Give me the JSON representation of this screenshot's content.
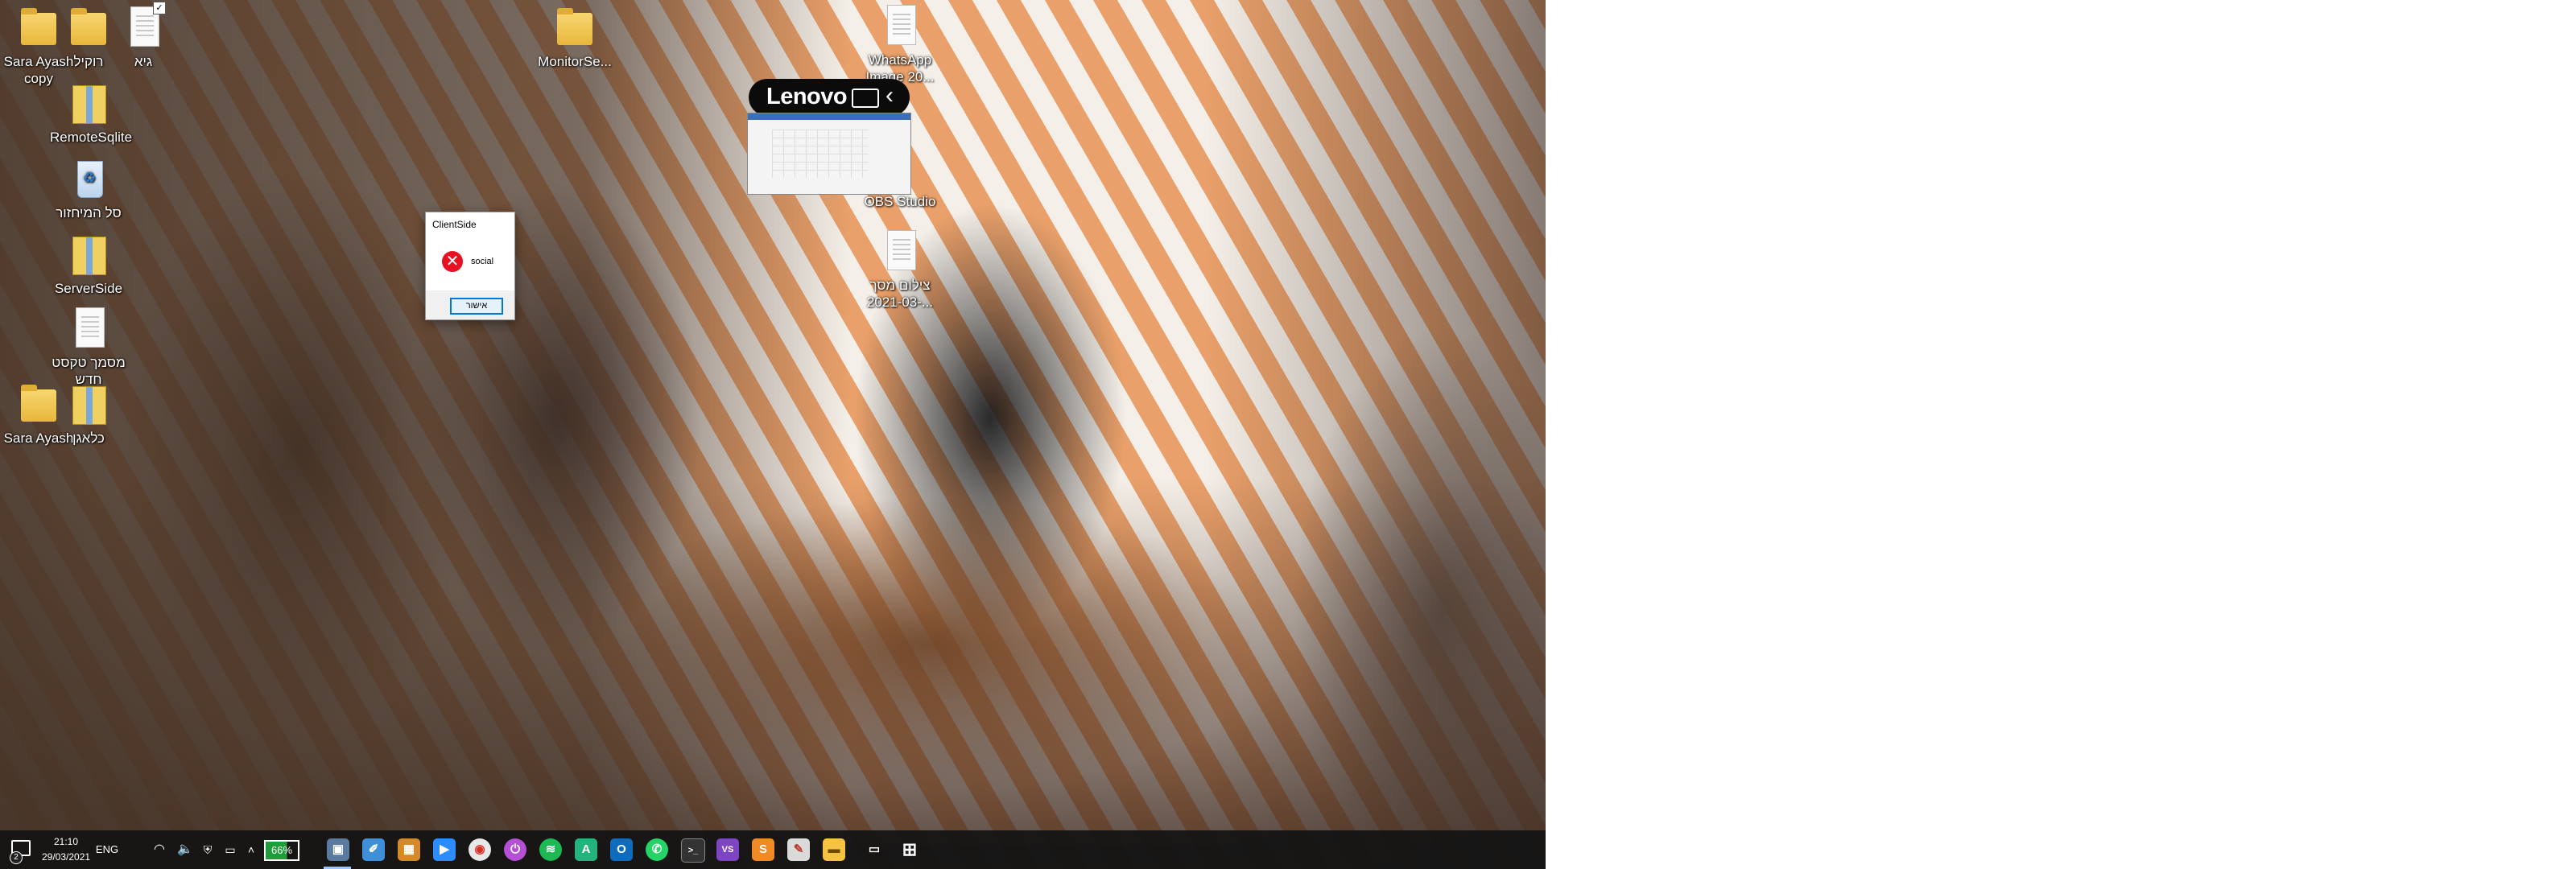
{
  "desktop": {
    "icons": [
      {
        "label": "Sara Ayash copy",
        "icon": "folder-icon"
      },
      {
        "label": "רוקיל",
        "icon": "folder-icon"
      },
      {
        "label": "גיא",
        "icon": "document-icon"
      },
      {
        "label": "MonitorSe...",
        "icon": "folder-icon"
      },
      {
        "label": "WhatsApp Image 20...",
        "icon": "image-file-icon"
      },
      {
        "label": "RemoteSqlite",
        "icon": "archive-icon"
      },
      {
        "label": "סל המיחזור",
        "icon": "recycle-bin-icon"
      },
      {
        "label": "OBS Studio",
        "icon": "obs-icon"
      },
      {
        "label": "ServerSide",
        "icon": "archive-icon"
      },
      {
        "label": "צילום מסך 2021-03-...",
        "icon": "image-file-icon"
      },
      {
        "label": "מסמך טקסט חדש",
        "icon": "text-file-icon"
      },
      {
        "label": "Sara Ayash",
        "icon": "folder-icon"
      },
      {
        "label": "כלאגן",
        "icon": "archive-icon"
      }
    ]
  },
  "lenovo_overlay": {
    "logo": "Lenovo"
  },
  "dialog": {
    "title": "ClientSide",
    "message": "social",
    "ok_label": "אישור",
    "error_color": "#e81123"
  },
  "taskbar": {
    "time": "21:10",
    "date": "29/03/2021",
    "language": "ENG",
    "battery": "66%",
    "notification_count": "2",
    "apps": [
      {
        "name": "windows-start-icon",
        "glyph": "⊞"
      },
      {
        "name": "task-view-icon",
        "glyph": "▭"
      },
      {
        "name": "file-explorer-icon",
        "glyph": "▬"
      },
      {
        "name": "paint-icon",
        "glyph": "✎"
      },
      {
        "name": "sublime-icon",
        "glyph": "S"
      },
      {
        "name": "visual-studio-icon",
        "glyph": "VS"
      },
      {
        "name": "terminal-icon",
        "glyph": ">_"
      },
      {
        "name": "whatsapp-icon",
        "glyph": "✆"
      },
      {
        "name": "outlook-icon",
        "glyph": "O"
      },
      {
        "name": "android-studio-icon",
        "glyph": "A"
      },
      {
        "name": "spotify-icon",
        "glyph": "≋"
      },
      {
        "name": "power-app-icon",
        "glyph": "⏻"
      },
      {
        "name": "chrome-icon",
        "glyph": "◉"
      },
      {
        "name": "zoom-icon",
        "glyph": "▶"
      },
      {
        "name": "photos-app-icon",
        "glyph": "▦"
      },
      {
        "name": "notes-app-icon",
        "glyph": "✐"
      },
      {
        "name": "window-app-icon",
        "glyph": "▣"
      }
    ]
  }
}
